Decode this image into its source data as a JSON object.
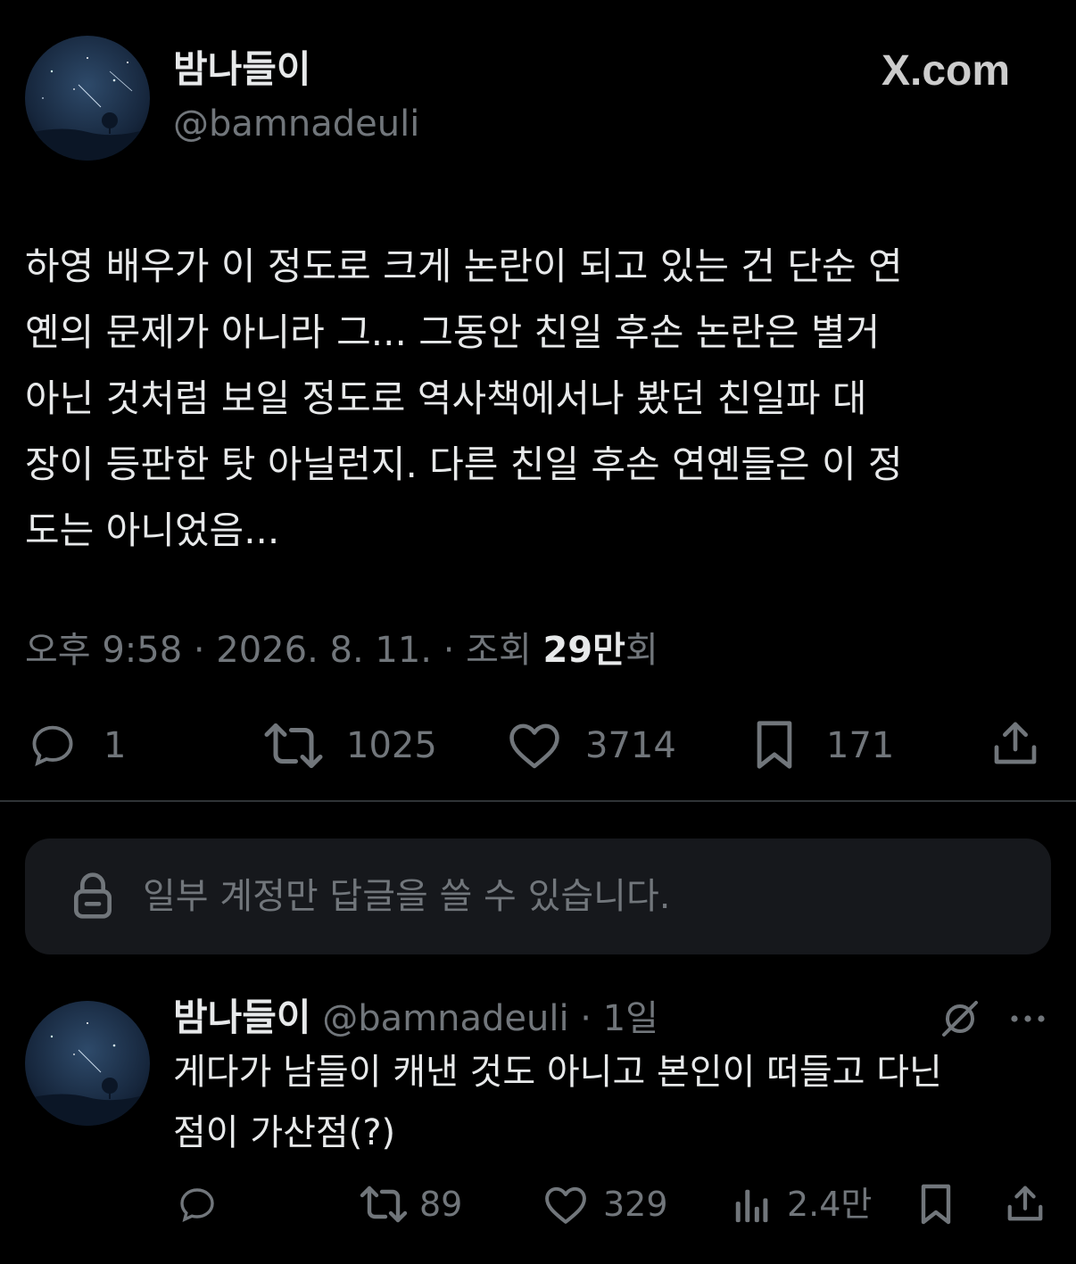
{
  "brand": {
    "site": "X.com"
  },
  "tweet": {
    "display_name": "밤나들이",
    "handle": "@bamnadeuli",
    "body_lines": [
      "하영 배우가 이 정도로 크게 논란이 되고 있는 건 단순 연",
      "옌의 문제가 아니라 그... 그동안 친일 후손 논란은 별거",
      "아닌 것처럼 보일 정도로 역사책에서나 봤던 친일파 대",
      "장이 등판한 탓 아닐런지. 다른 친일 후손 연옌들은 이 정",
      "도는 아니었음..."
    ],
    "meta_prefix": "오후 9:58 · 2026. 8. 11. · 조회 ",
    "views_count": "29만",
    "views_suffix": "회",
    "actions": {
      "replies": "1",
      "retweets": "1025",
      "likes": "3714",
      "bookmarks": "171"
    }
  },
  "reply_restriction": {
    "text": "일부 계정만 답글을 쓸 수 있습니다."
  },
  "reply": {
    "display_name": "밤나들이",
    "handle_time": "@bamnadeuli · 1일",
    "body_lines": [
      "게다가 남들이 캐낸 것도 아니고 본인이 떠들고 다닌",
      "점이 가산점(?)"
    ],
    "actions": {
      "retweets": "89",
      "likes": "329",
      "views": "2.4만"
    }
  },
  "colors": {
    "background": "#000000",
    "text": "#e7e9ea",
    "muted": "#71767b",
    "panel": "#16181c",
    "divider": "#2f3336"
  },
  "icons": [
    "reply-icon",
    "retweet-icon",
    "heart-icon",
    "bookmark-icon",
    "share-icon",
    "lock-icon",
    "grok-icon",
    "more-icon",
    "views-icon",
    "x-logo-icon"
  ]
}
